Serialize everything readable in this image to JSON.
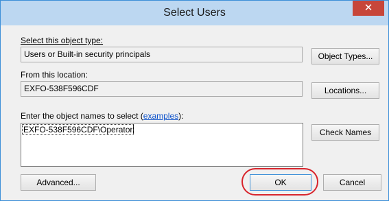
{
  "window": {
    "title": "Select Users",
    "close_glyph": "✕"
  },
  "object_type": {
    "label": "Select this object type:",
    "value": "Users or Built-in security principals",
    "button": "Object Types..."
  },
  "location": {
    "label": "From this location:",
    "value": "EXFO-538F596CDF",
    "button": "Locations..."
  },
  "names": {
    "label_prefix": "Enter the object names to select (",
    "label_link": "examples",
    "label_suffix": "):",
    "value": "EXFO-538F596CDF\\Operator",
    "button": "Check Names"
  },
  "footer": {
    "advanced_button": "Advanced...",
    "ok_button": "OK",
    "cancel_button": "Cancel"
  },
  "colors": {
    "titlebar": "#bcd7f1",
    "close": "#c7463a",
    "highlight": "#d8242c",
    "link": "#1155cc"
  }
}
